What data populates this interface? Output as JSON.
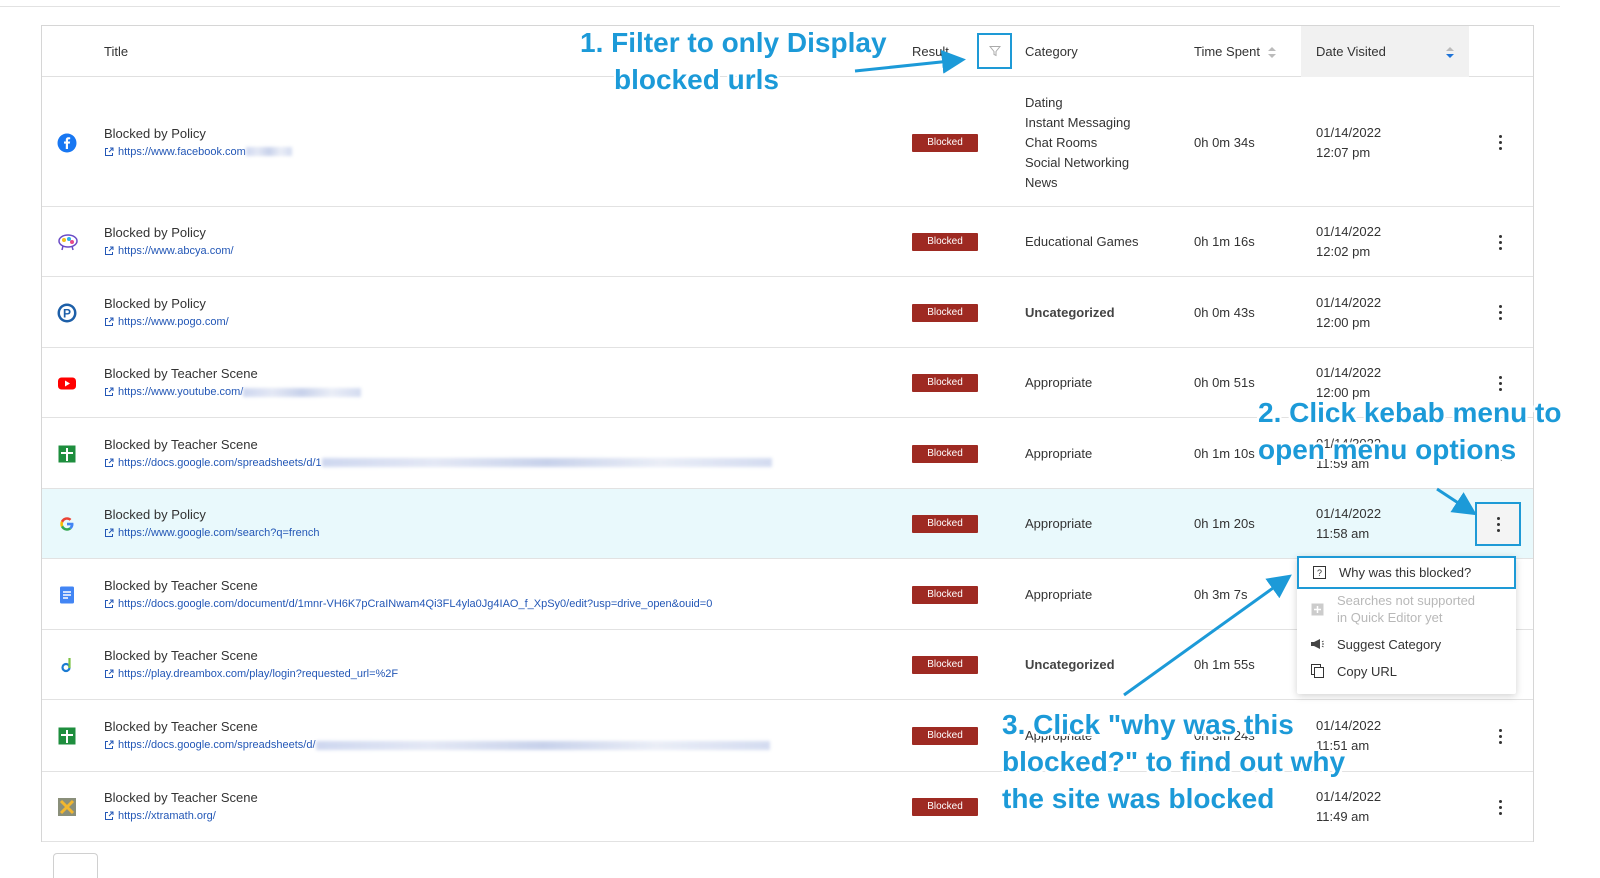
{
  "table": {
    "headers": {
      "title": "Title",
      "result": "Result",
      "category": "Category",
      "time_spent": "Time Spent",
      "date_visited": "Date Visited"
    },
    "sort": {
      "column": "Date Visited",
      "direction": "descending"
    },
    "rows": [
      {
        "icon": "facebook-icon",
        "title": "Blocked by Policy",
        "url": "https://www.facebook.com",
        "url_redacted": true,
        "result": "Blocked",
        "categories": [
          "Dating",
          "Instant Messaging",
          "Chat Rooms",
          "Social Networking",
          "News"
        ],
        "time_spent": "0h 0m 34s",
        "date": "01/14/2022",
        "time": "12:07 pm"
      },
      {
        "icon": "abcya-icon",
        "title": "Blocked by Policy",
        "url": "https://www.abcya.com/",
        "url_redacted": false,
        "result": "Blocked",
        "categories": [
          "Educational Games"
        ],
        "time_spent": "0h 1m 16s",
        "date": "01/14/2022",
        "time": "12:02 pm"
      },
      {
        "icon": "pogo-icon",
        "title": "Blocked by Policy",
        "url": "https://www.pogo.com/",
        "url_redacted": false,
        "result": "Blocked",
        "categories": [
          "Uncategorized"
        ],
        "time_spent": "0h 0m 43s",
        "date": "01/14/2022",
        "time": "12:00 pm"
      },
      {
        "icon": "youtube-icon",
        "title": "Blocked by Teacher Scene",
        "url": "https://www.youtube.com/",
        "url_redacted": true,
        "result": "Blocked",
        "categories": [
          "Appropriate"
        ],
        "time_spent": "0h 0m 51s",
        "date": "01/14/2022",
        "time": "12:00 pm"
      },
      {
        "icon": "google-sheets-icon",
        "title": "Blocked by Teacher Scene",
        "url": "https://docs.google.com/spreadsheets/d/1",
        "url_redacted": true,
        "result": "Blocked",
        "categories": [
          "Appropriate"
        ],
        "time_spent": "0h 1m 10s",
        "date": "01/14/2022",
        "time": "11:59 am"
      },
      {
        "icon": "google-icon",
        "title": "Blocked by Policy",
        "url": "https://www.google.com/search?q=french",
        "url_redacted": false,
        "result": "Blocked",
        "categories": [
          "Appropriate"
        ],
        "time_spent": "0h 1m 20s",
        "date": "01/14/2022",
        "time": "11:58 am"
      },
      {
        "icon": "google-docs-icon",
        "title": "Blocked by Teacher Scene",
        "url": "https://docs.google.com/document/d/1mnr-VH6K7pCraINwam4Qi3FL4yla0Jg4IAO_f_XpSy0/edit?usp=drive_open&ouid=0",
        "url_redacted": false,
        "result": "Blocked",
        "categories": [
          "Appropriate"
        ],
        "time_spent": "0h 3m 7s",
        "date": "",
        "time": ""
      },
      {
        "icon": "dreambox-icon",
        "title": "Blocked by Teacher Scene",
        "url": "https://play.dreambox.com/play/login?requested_url=%2F",
        "url_redacted": false,
        "result": "Blocked",
        "categories": [
          "Uncategorized"
        ],
        "time_spent": "0h 1m 55s",
        "date": "",
        "time": ""
      },
      {
        "icon": "google-sheets-icon",
        "title": "Blocked by Teacher Scene",
        "url": "https://docs.google.com/spreadsheets/d/",
        "url_redacted": true,
        "result": "Blocked",
        "categories": [
          "Appropriate"
        ],
        "time_spent": "0h 3m 24s",
        "date": "01/14/2022",
        "time": "11:51 am"
      },
      {
        "icon": "xtramath-icon",
        "title": "Blocked by Teacher Scene",
        "url": "https://xtramath.org/",
        "url_redacted": false,
        "result": "Blocked",
        "categories": [],
        "time_spent": "",
        "date": "01/14/2022",
        "time": "11:49 am"
      }
    ]
  },
  "context_menu": {
    "items": [
      {
        "label": "Why was this blocked?",
        "icon": "question-icon",
        "disabled": false,
        "selected": true
      },
      {
        "label": "Searches not supported\nin Quick Editor yet",
        "icon": "add-box-icon",
        "disabled": true,
        "selected": false
      },
      {
        "label": "Suggest Category",
        "icon": "megaphone-icon",
        "disabled": false,
        "selected": false
      },
      {
        "label": "Copy URL",
        "icon": "copy-icon",
        "disabled": false,
        "selected": false
      }
    ]
  },
  "annotations": {
    "step1_line1": "1.  Filter to only Display",
    "step1_line2": "blocked urls",
    "step2_line1": "2. Click kebab menu to",
    "step2_line2": "open menu options",
    "step3_line1": "3. Click \"why was this",
    "step3_line2": "blocked?\" to find out why",
    "step3_line3": "the site was blocked"
  },
  "colors": {
    "blocked_badge": "#9e2a22",
    "link": "#2357b6",
    "annotation": "#1c9ad8",
    "highlight_row": "#e9f9fc"
  }
}
